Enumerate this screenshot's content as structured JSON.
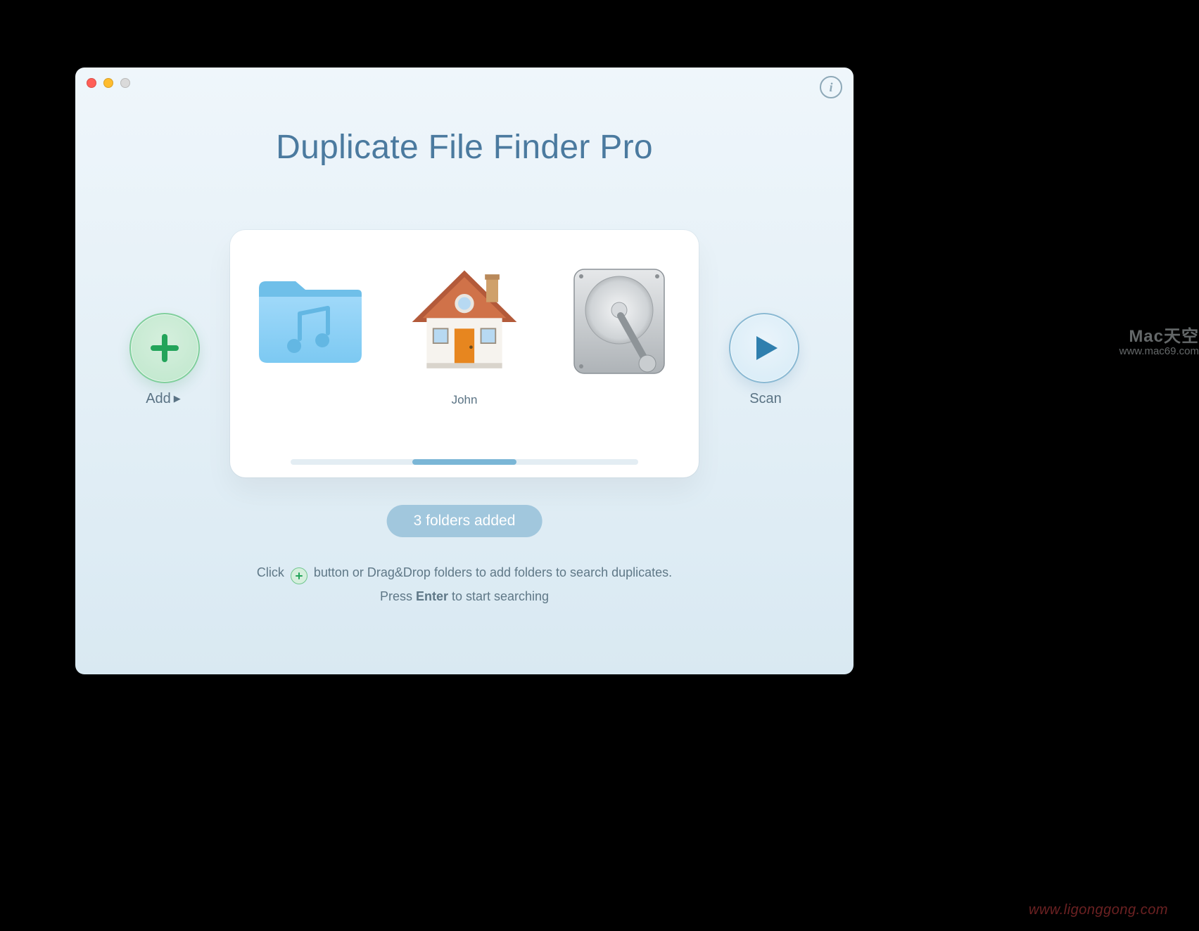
{
  "app_title": "Duplicate File Finder Pro",
  "info_tooltip": "i",
  "add": {
    "label": "Add"
  },
  "scan": {
    "label": "Scan"
  },
  "folders": {
    "items": [
      {
        "label": "",
        "icon": "music-folder"
      },
      {
        "label": "John",
        "icon": "home-folder"
      },
      {
        "label": "",
        "icon": "disk-drive"
      }
    ],
    "count_text": "3 folders added"
  },
  "help": {
    "line1_before": "Click ",
    "line1_after": " button or Drag&Drop folders to add folders to search duplicates.",
    "line2_before": "Press ",
    "line2_bold": "Enter",
    "line2_after": " to start searching"
  },
  "watermarks": {
    "right_title": "Mac天空",
    "right_url": "www.mac69.com",
    "bottom": "www.ligonggong.com"
  }
}
